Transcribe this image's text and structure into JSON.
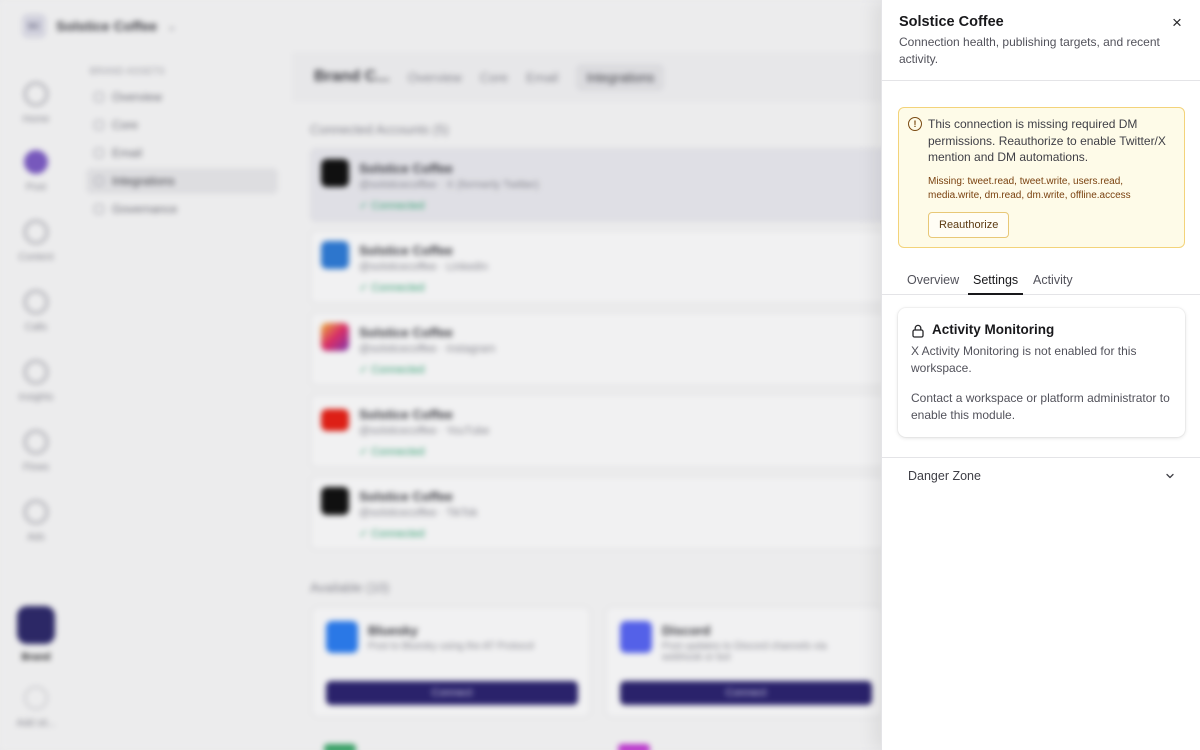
{
  "background": {
    "workspace": {
      "initials": "SC",
      "name": "Solstice Coffee"
    },
    "rail": [
      {
        "label": "Home"
      },
      {
        "label": "Post"
      },
      {
        "label": "Content"
      },
      {
        "label": "Calls"
      },
      {
        "label": "Insights"
      },
      {
        "label": "Flows"
      },
      {
        "label": "Ads"
      },
      {
        "label": "Brand"
      },
      {
        "label": "Add sit..."
      }
    ],
    "subnav": {
      "heading": "BRAND ASSETS",
      "items": [
        "Overview",
        "Core",
        "Email",
        "Integrations",
        "Governance"
      ]
    },
    "topbar": {
      "title": "Brand C...",
      "tabs": [
        "Overview",
        "Core",
        "Email",
        "Integrations"
      ]
    },
    "connected_label": "Connected Accounts (5)",
    "accounts": [
      {
        "name": "Solstice Coffee",
        "sub": "@solsticecoffee · X (formerly Twitter)",
        "status": "✓ Connected"
      },
      {
        "name": "Solstice Coffee",
        "sub": "@solsticecoffee · LinkedIn",
        "status": "✓ Connected"
      },
      {
        "name": "Solstice Coffee",
        "sub": "@solsticecoffee · Instagram",
        "status": "✓ Connected"
      },
      {
        "name": "Solstice Coffee",
        "sub": "@solsticecoffee · YouTube",
        "status": "✓ Connected"
      },
      {
        "name": "Solstice Coffee",
        "sub": "@solsticecoffee · TikTok",
        "status": "✓ Connected"
      }
    ],
    "available_label": "Available (10)",
    "available": [
      {
        "name": "Bluesky",
        "desc": "Post to Bluesky using the AT Protocol",
        "button": "Connect"
      },
      {
        "name": "Discord",
        "desc": "Post updates to Discord channels via webhook or bot",
        "button": "Connect"
      }
    ]
  },
  "drawer": {
    "title": "Solstice Coffee",
    "subtitle": "Connection health, publishing targets, and recent activity.",
    "close_icon": "×",
    "warning": {
      "icon": "!",
      "message": "This connection is missing required DM permissions. Reauthorize to enable Twitter/X mention and DM automations.",
      "missing": "Missing: tweet.read, tweet.write, users.read, media.write, dm.read, dm.write, offline.access",
      "button": "Reauthorize",
      "bg_color": "#fefbe8",
      "border_color": "#f3d37a"
    },
    "tabs": [
      {
        "label": "Overview",
        "active": false
      },
      {
        "label": "Settings",
        "active": true
      },
      {
        "label": "Activity",
        "active": false
      }
    ],
    "card": {
      "title": "Activity Monitoring",
      "p1": "X Activity Monitoring is not enabled for this workspace.",
      "p2": "Contact a workspace or platform administrator to enable this module."
    },
    "danger_zone": {
      "label": "Danger Zone",
      "expanded": false
    }
  }
}
